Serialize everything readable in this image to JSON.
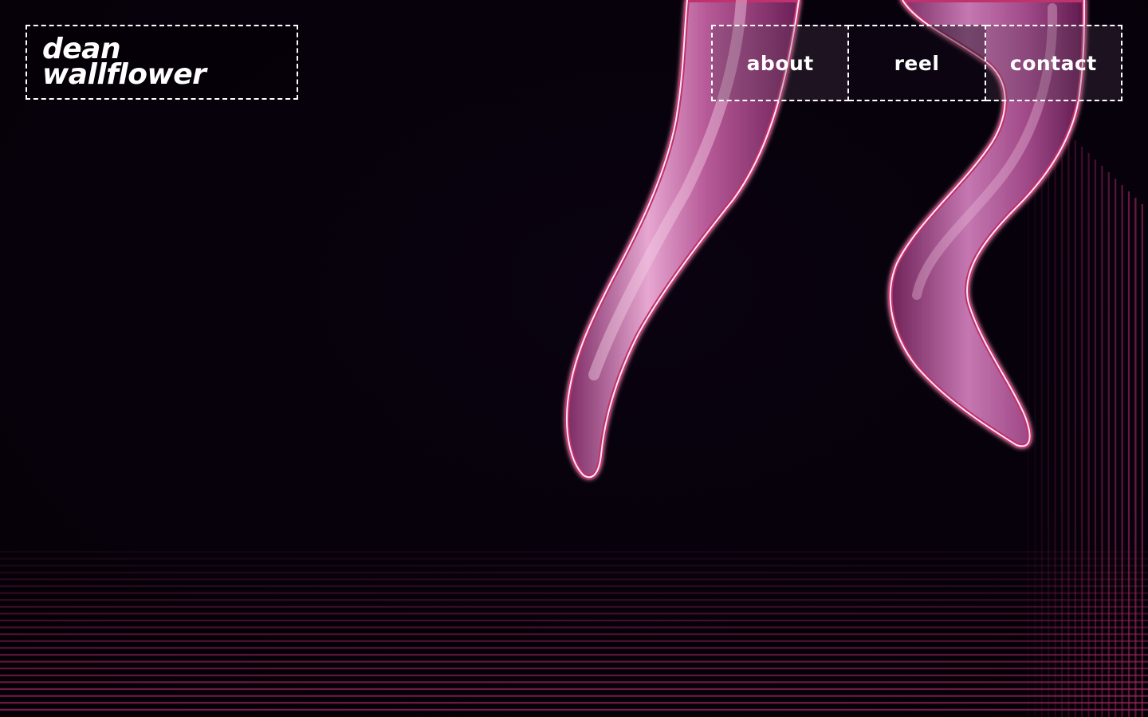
{
  "site": {
    "logo_line1": "dean",
    "logo_line2": "wallflower"
  },
  "nav": {
    "items": [
      {
        "label": "about"
      },
      {
        "label": "reel"
      },
      {
        "label": "contact"
      }
    ]
  },
  "colors": {
    "background": "#07010a",
    "accent_pink": "#c0306e",
    "text": "#ffffff"
  },
  "icons": {
    "hero_art": "neon-legs-illustration"
  }
}
